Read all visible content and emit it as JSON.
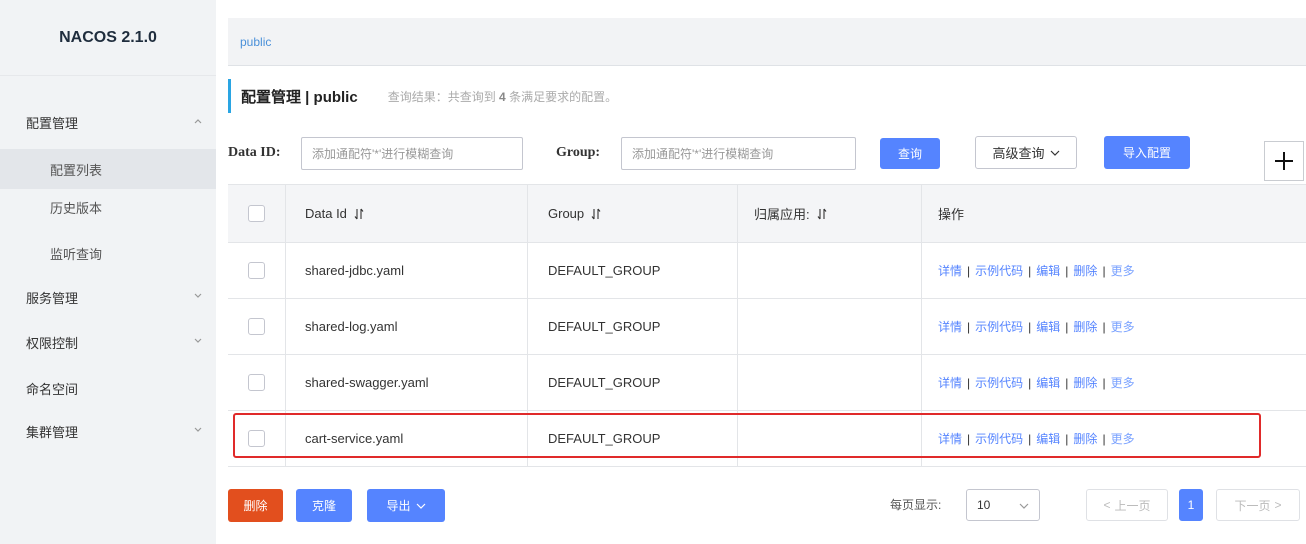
{
  "app": {
    "brand": "NACOS 2.1.0"
  },
  "sidebar": {
    "items": [
      {
        "label": "配置管理",
        "expanded": true
      },
      {
        "label": "配置列表",
        "sub": true,
        "active": true
      },
      {
        "label": "历史版本",
        "sub": true
      },
      {
        "label": "监听查询",
        "sub": true
      },
      {
        "label": "服务管理",
        "expanded": false
      },
      {
        "label": "权限控制",
        "expanded": false
      },
      {
        "label": "命名空间"
      },
      {
        "label": "集群管理",
        "expanded": false
      }
    ]
  },
  "breadcrumb": {
    "namespace": "public"
  },
  "header": {
    "title": "配置管理 | public",
    "result_prefix": "查询结果：共查询到 ",
    "result_count": "4",
    "result_suffix": " 条满足要求的配置。"
  },
  "search": {
    "dataid_label": "Data ID:",
    "dataid_placeholder": "添加通配符'*'进行模糊查询",
    "group_label": "Group:",
    "group_placeholder": "添加通配符'*'进行模糊查询",
    "query_btn": "查询",
    "advanced_btn": "高级查询",
    "import_btn": "导入配置",
    "add_btn": "+"
  },
  "table": {
    "headers": [
      "Data Id",
      "Group",
      "归属应用:",
      "操作"
    ],
    "rows": [
      {
        "data_id": "shared-jdbc.yaml",
        "group": "DEFAULT_GROUP",
        "app": ""
      },
      {
        "data_id": "shared-log.yaml",
        "group": "DEFAULT_GROUP",
        "app": ""
      },
      {
        "data_id": "shared-swagger.yaml",
        "group": "DEFAULT_GROUP",
        "app": ""
      },
      {
        "data_id": "cart-service.yaml",
        "group": "DEFAULT_GROUP",
        "app": "",
        "highlighted": true
      }
    ],
    "actions": {
      "detail": "详情",
      "sample": "示例代码",
      "edit": "编辑",
      "delete": "删除",
      "more": "更多"
    }
  },
  "footer": {
    "delete_btn": "删除",
    "clone_btn": "克隆",
    "export_btn": "导出",
    "pagesize_label": "每页显示:",
    "pagesize_value": "10",
    "prev": "上一页",
    "current_page": "1",
    "next": "下一页"
  },
  "colors": {
    "primary": "#5584ff",
    "danger": "#e24f1e",
    "highlight": "#e02a2a"
  }
}
